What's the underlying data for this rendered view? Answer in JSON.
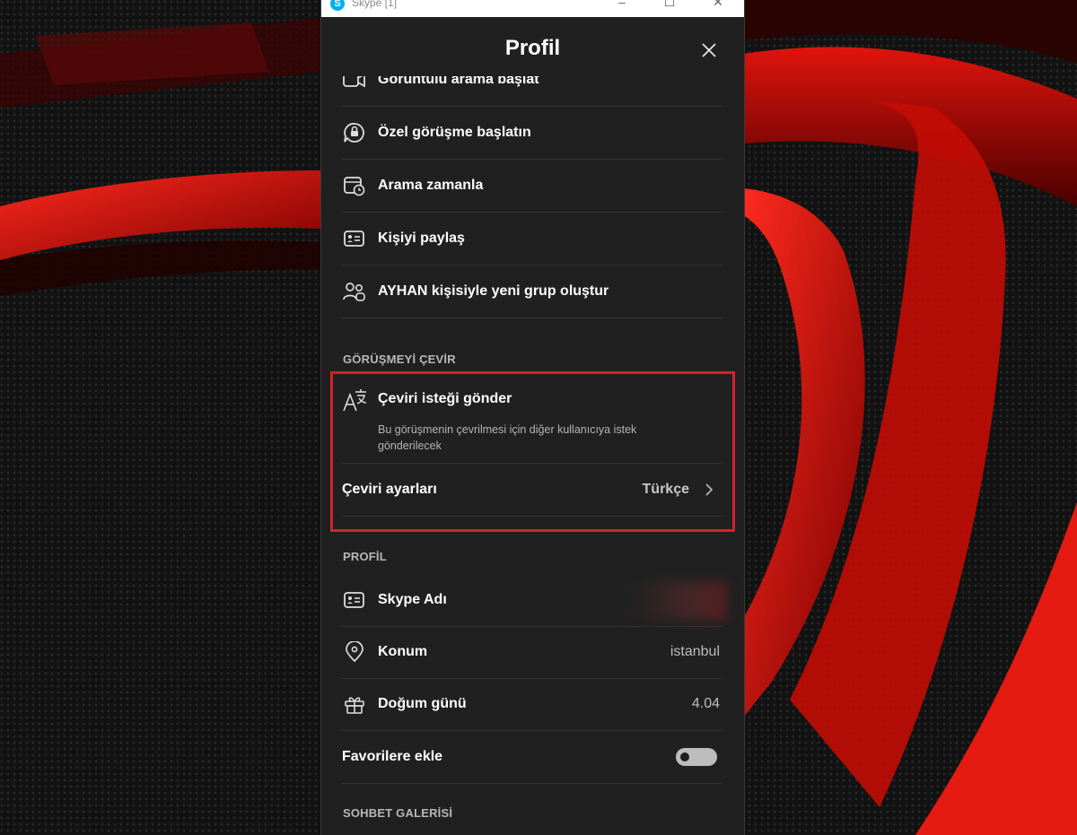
{
  "window": {
    "app_title": "Skype [1]",
    "controls": [
      "–",
      "☐",
      "✕"
    ]
  },
  "header": {
    "title": "Profil"
  },
  "actions": [
    {
      "label": "Görüntülü arama başlat",
      "icon": "video-icon"
    },
    {
      "label": "Özel görüşme başlatın",
      "icon": "lock-chat-icon"
    },
    {
      "label": "Arama zamanla",
      "icon": "calendar-clock-icon"
    },
    {
      "label": "Kişiyi paylaş",
      "icon": "contact-card-icon"
    },
    {
      "label": "AYHAN kişisiyle yeni grup oluştur",
      "icon": "people-add-icon"
    }
  ],
  "translate": {
    "section_title": "GÖRÜŞMEYİ ÇEVİR",
    "send_request_label": "Çeviri isteği gönder",
    "send_request_desc": "Bu görüşmenin çevrilmesi için diğer kullanıcıya istek gönderilecek",
    "settings_label": "Çeviri ayarları",
    "settings_value": "Türkçe",
    "highlight_color": "#d8202b"
  },
  "profile": {
    "section_title": "PROFİL",
    "skype_name_label": "Skype Adı",
    "location_label": "Konum",
    "location_value": "istanbul",
    "birthday_label": "Doğum günü",
    "birthday_value": "4.04",
    "favorites_label": "Favorilere ekle",
    "favorites_on": false
  },
  "gallery": {
    "section_title": "SOHBET GALERİSİ"
  }
}
